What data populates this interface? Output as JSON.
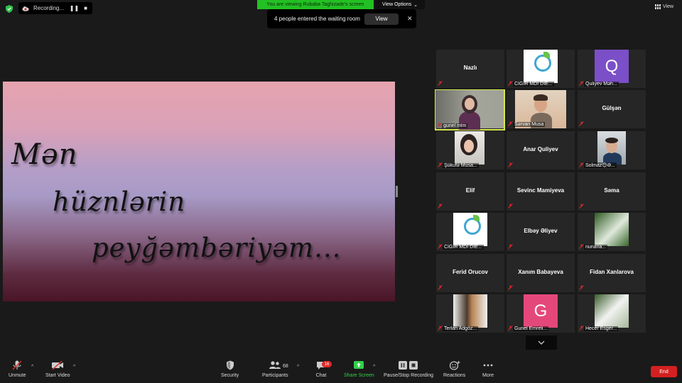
{
  "top": {
    "recording_label": "Recording...",
    "pause_glyph": "❚❚",
    "stop_glyph": "■",
    "viewing_banner": "You are viewing Rubaba Taghizade's screen",
    "view_options_label": "View Options",
    "view_label": "View"
  },
  "waiting_room": {
    "message": "4 people entered the waiting room",
    "view_button": "View",
    "close_glyph": "✕"
  },
  "slide": {
    "line1": "Mən",
    "line2": "hüznlərin",
    "line3": "peyğəmbəriyəm..."
  },
  "gallery": {
    "tiles": [
      {
        "name": "Nazlı"
      },
      {
        "name": "CİĞİR MDİ DİE..."
      },
      {
        "name": "Quliyev Məh...",
        "initial": "Q"
      },
      {
        "name": "gunel mlm"
      },
      {
        "name": "Sərvan Musa"
      },
      {
        "name": "Gülşən"
      },
      {
        "name": "Şükufə Musa..."
      },
      {
        "name": "Anar Quliyev"
      },
      {
        "name": "Solmaz😊Ə..."
      },
      {
        "name": "Elif"
      },
      {
        "name": "Sevinc Mamiyeva"
      },
      {
        "name": "Səma"
      },
      {
        "name": "CİĞİR MDİ DİE..."
      },
      {
        "name": "Elbəy Əliyev"
      },
      {
        "name": "nuriana..."
      },
      {
        "name": "Ferid Orucov"
      },
      {
        "name": "Xanım Babayeva"
      },
      {
        "name": "Fidan Xanlarova"
      },
      {
        "name": "Terlan Adgöz..."
      },
      {
        "name": "Gunel Emreli...",
        "initial": "G"
      },
      {
        "name": "Hecer Esger..."
      }
    ]
  },
  "toolbar": {
    "unmute": "Unmute",
    "start_video": "Start Video",
    "security": "Security",
    "participants": "Participants",
    "participants_count": "68",
    "chat": "Chat",
    "chat_badge": "16",
    "share_screen": "Share Screen",
    "pause_stop_recording": "Pause/Stop Recording",
    "reactions": "Reactions",
    "more": "More",
    "end": "End"
  },
  "colors": {
    "banner_green": "#23c023",
    "active_speaker": "#d6e84c",
    "end_red": "#d42020",
    "share_green": "#31d14a",
    "muted_red": "#e02828"
  }
}
